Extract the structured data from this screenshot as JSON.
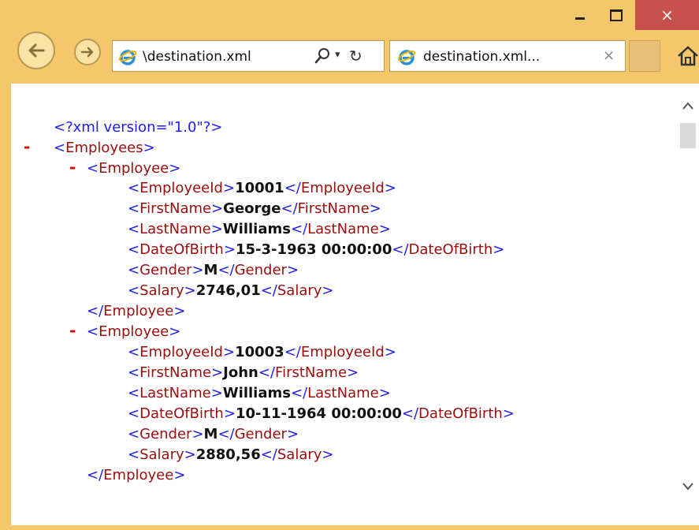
{
  "window": {
    "buttons": {
      "minimize": "minimize",
      "maximize": "maximize",
      "close": "×"
    }
  },
  "address_bar": {
    "url": "\\destination.xml",
    "search_icon": "search-icon",
    "dropdown": "▾",
    "refresh": "↻"
  },
  "tab": {
    "title": "destination.xml...",
    "close": "×"
  },
  "xml": {
    "declaration": "<?xml version=\"1.0\"?>",
    "root_open": "Employees",
    "employee_tag": "Employee",
    "employees": [
      {
        "fields": [
          {
            "tag": "EmployeeId",
            "value": "10001"
          },
          {
            "tag": "FirstName",
            "value": "George"
          },
          {
            "tag": "LastName",
            "value": "Williams"
          },
          {
            "tag": "DateOfBirth",
            "value": "15-3-1963 00:00:00"
          },
          {
            "tag": "Gender",
            "value": "M"
          },
          {
            "tag": "Salary",
            "value": "2746,01"
          }
        ]
      },
      {
        "fields": [
          {
            "tag": "EmployeeId",
            "value": "10003"
          },
          {
            "tag": "FirstName",
            "value": "John"
          },
          {
            "tag": "LastName",
            "value": "Williams"
          },
          {
            "tag": "DateOfBirth",
            "value": "10-11-1964 00:00:00"
          },
          {
            "tag": "Gender",
            "value": "M"
          },
          {
            "tag": "Salary",
            "value": "2880,56"
          }
        ]
      }
    ],
    "collapse_marker": "-"
  },
  "colors": {
    "frame": "#f4c86a",
    "close_button": "#c7504a",
    "xml_markup": "#1d1df2",
    "xml_tagname": "#9a0e0e",
    "collapse_marker": "#e20000"
  }
}
